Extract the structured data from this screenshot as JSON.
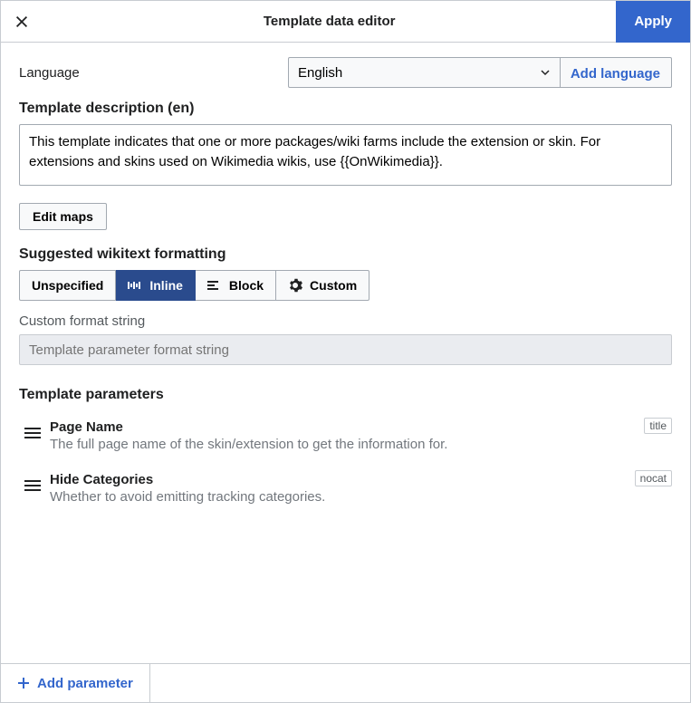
{
  "header": {
    "title": "Template data editor",
    "apply": "Apply"
  },
  "language": {
    "label": "Language",
    "selected": "English",
    "add_link": "Add language"
  },
  "description": {
    "label": "Template description (en)",
    "value": "This template indicates that one or more packages/wiki farms include the extension or skin. For extensions and skins used on Wikimedia wikis, use {{OnWikimedia}}."
  },
  "edit_maps": "Edit maps",
  "formatting": {
    "label": "Suggested wikitext formatting",
    "options": [
      "Unspecified",
      "Inline",
      "Block",
      "Custom"
    ],
    "active": "Inline",
    "custom_label": "Custom format string",
    "custom_placeholder": "Template parameter format string"
  },
  "parameters": {
    "label": "Template parameters",
    "items": [
      {
        "name": "Page Name",
        "desc": "The full page name of the skin/extension to get the information for.",
        "tag": "title"
      },
      {
        "name": "Hide Categories",
        "desc": "Whether to avoid emitting tracking categories.",
        "tag": "nocat"
      }
    ]
  },
  "footer": {
    "add_parameter": "Add parameter"
  }
}
